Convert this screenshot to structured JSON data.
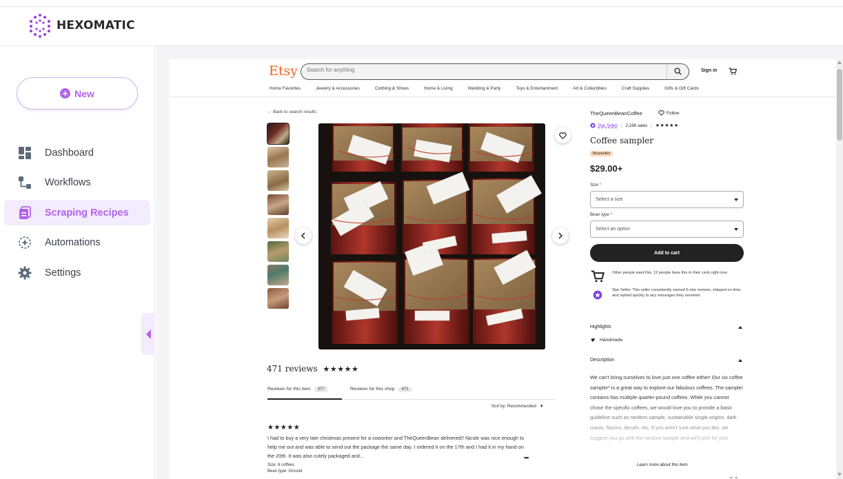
{
  "app": {
    "logo_text": "HEXOMATIC",
    "new_button": "New",
    "nav": [
      {
        "label": "Dashboard",
        "icon": "dashboard-icon",
        "active": false
      },
      {
        "label": "Workflows",
        "icon": "workflows-icon",
        "active": false
      },
      {
        "label": "Scraping Recipes",
        "icon": "scraping-recipes-icon",
        "active": true
      },
      {
        "label": "Automations",
        "icon": "automations-icon",
        "active": false
      },
      {
        "label": "Settings",
        "icon": "gear-icon",
        "active": false
      }
    ],
    "accent_color": "#b264e8"
  },
  "etsy": {
    "logo": "Etsy",
    "search_placeholder": "Search for anything",
    "signin": "Sign in",
    "categories": [
      "Home Favorites",
      "Jewelry & Accessories",
      "Clothing & Shoes",
      "Home & Living",
      "Wedding & Party",
      "Toys & Entertainment",
      "Art & Collectibles",
      "Craft Supplies",
      "Gifts & Gift Cards"
    ],
    "back_link": "← Back to search results",
    "reviews_title": "471 reviews",
    "stars": "★★★★★",
    "review_tabs": [
      {
        "label": "Reviews for this item",
        "count": "377"
      },
      {
        "label": "Reviews for this shop",
        "count": "471"
      }
    ],
    "sort_by": "Sort by: Recommended",
    "review": {
      "stars": "★★★★★",
      "text": "I had to buy a very late christmas present for a coworker and TheQueenBean delivered!! Nicole was nice enough to help me out and was able to send out the package the same day. I ordered it on the 17th and I had it in my hand on the 20th. It was also cutely packaged and...",
      "size": "Size: 6 coffees",
      "bean_type": "Bean type: Ground"
    },
    "shop_name": "TheQueenBeanCoffee",
    "follow": "Follow",
    "star_seller": "Star Seller",
    "sales": "2,198 sales",
    "title": "Coffee sampler",
    "bestseller": "Bestseller",
    "price": "$29.00+",
    "size_label": "Size",
    "size_placeholder": "Select a size",
    "bean_label": "Bean type",
    "bean_placeholder": "Select an option",
    "add_to_cart": "Add to cart",
    "info_carts": "Other people want this. 12 people have this in their carts right now.",
    "info_star_seller": "Star Seller. This seller consistently earned 5-star reviews, shipped on time, and replied quickly to any messages they received.",
    "highlights": "Highlights",
    "handmade": "Handmade",
    "description_head": "Description",
    "description": "We can't bring ourselves to love just one coffee either! Our six coffee sampler* is a great way to explore our fabulous coffees. The sampler contains has multiple quarter-pound coffees. While you cannot chose the specific coffees, we would love you to provide a basic guideline such as random sample, sustainable single origins, dark roasts, flavors, decafs, etc. If you aren't sure what you like, we suggest you go with the random sample and we'll pick for you!",
    "learn_more": "Learn more about this item"
  }
}
